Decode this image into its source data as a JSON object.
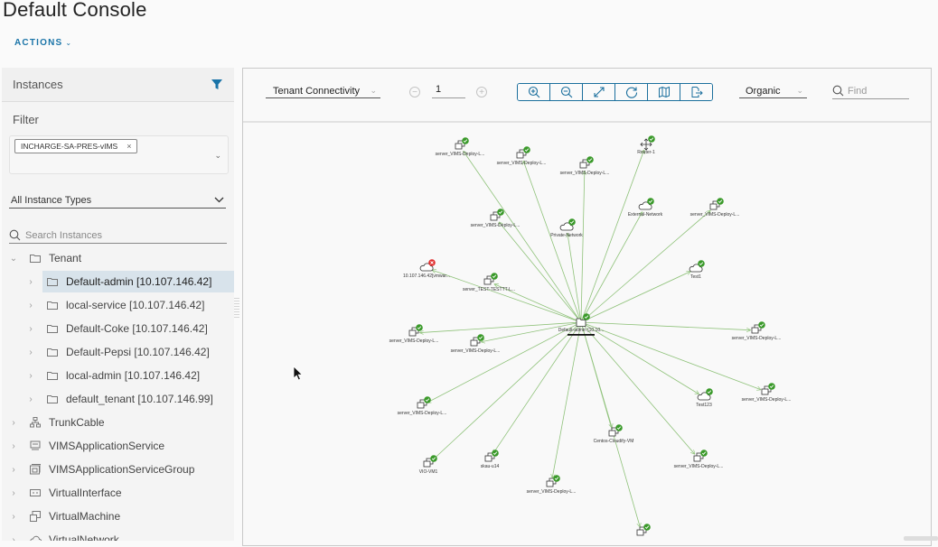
{
  "page": {
    "title": "Default Console",
    "actions_label": "ACTIONS"
  },
  "sidebar": {
    "header": "Instances",
    "filter_label": "Filter",
    "filter_tags": [
      "INCHARGE-SA-PRES-vIMS"
    ],
    "instance_type": "All Instance Types",
    "search_placeholder": "Search Instances",
    "tree": [
      {
        "label": "Tenant",
        "level": 0,
        "expanded": true,
        "icon": "folder-icon"
      },
      {
        "label": "Default-admin [10.107.146.42]",
        "level": 1,
        "selected": true,
        "icon": "folder-icon"
      },
      {
        "label": "local-service [10.107.146.42]",
        "level": 1,
        "icon": "folder-icon"
      },
      {
        "label": "Default-Coke [10.107.146.42]",
        "level": 1,
        "icon": "folder-icon"
      },
      {
        "label": "Default-Pepsi [10.107.146.42]",
        "level": 1,
        "icon": "folder-icon"
      },
      {
        "label": "local-admin [10.107.146.42]",
        "level": 1,
        "icon": "folder-icon"
      },
      {
        "label": "default_tenant [10.107.146.99]",
        "level": 1,
        "icon": "folder-icon"
      },
      {
        "label": "TrunkCable",
        "level": 0,
        "icon": "network-tree-icon"
      },
      {
        "label": "VIMSApplicationService",
        "level": 0,
        "icon": "application-service-icon"
      },
      {
        "label": "VIMSApplicationServiceGroup",
        "level": 0,
        "icon": "service-group-icon"
      },
      {
        "label": "VirtualInterface",
        "level": 0,
        "icon": "interface-icon"
      },
      {
        "label": "VirtualMachine",
        "level": 0,
        "icon": "vm-icon"
      },
      {
        "label": "VirtualNetwork",
        "level": 0,
        "icon": "cloud-icon"
      }
    ]
  },
  "toolbar": {
    "view": "Tenant Connectivity",
    "hop_value": "1",
    "buttons": [
      {
        "name": "zoom-in-button",
        "icon": "zoom-in-icon"
      },
      {
        "name": "zoom-out-button",
        "icon": "zoom-out-icon"
      },
      {
        "name": "fit-to-screen-button",
        "icon": "expand-icon"
      },
      {
        "name": "refresh-button",
        "icon": "refresh-icon"
      },
      {
        "name": "map-button",
        "icon": "map-icon"
      },
      {
        "name": "export-button",
        "icon": "export-icon"
      }
    ],
    "layout": "Organic",
    "find_placeholder": "Find"
  },
  "graph": {
    "center": {
      "label": "Default-admin [10.10...",
      "type": "folder",
      "status": "ok"
    },
    "colors": {
      "edge": "#8fc27a",
      "ok": "#3a9a2a",
      "error": "#e12e2e"
    },
    "nodes": [
      {
        "label": "server_VIMS-Deploy-L...",
        "type": "vm",
        "status": "ok"
      },
      {
        "label": "server_VIMS-Deploy-L...",
        "type": "vm",
        "status": "ok"
      },
      {
        "label": "server_VIMS-Deploy-L...",
        "type": "vm",
        "status": "ok"
      },
      {
        "label": "Router-1",
        "type": "router",
        "status": "ok"
      },
      {
        "label": "server_VIMS-Deploy-L...",
        "type": "vm",
        "status": "ok"
      },
      {
        "label": "Private-Network",
        "type": "cloud",
        "status": "ok"
      },
      {
        "label": "External-Network",
        "type": "cloud",
        "status": "ok"
      },
      {
        "label": "server_VIMS-Deploy-L...",
        "type": "vm",
        "status": "ok"
      },
      {
        "label": "10.107.146.42[vmwar...",
        "type": "cloud",
        "status": "error"
      },
      {
        "label": "server_TEST-TESTTT-L...",
        "type": "vm",
        "status": "ok"
      },
      {
        "label": "Test1",
        "type": "cloud",
        "status": "ok"
      },
      {
        "label": "server_VIMS-Deploy-L...",
        "type": "vm",
        "status": "ok"
      },
      {
        "label": "server_VIMS-Deploy-L...",
        "type": "vm",
        "status": "ok"
      },
      {
        "label": "server_VIMS-Deploy-L...",
        "type": "vm",
        "status": "ok"
      },
      {
        "label": "Test123",
        "type": "cloud",
        "status": "ok"
      },
      {
        "label": "server_VIMS-Deploy-L...",
        "type": "vm",
        "status": "ok"
      },
      {
        "label": "server_VIMS-Deploy-L...",
        "type": "vm",
        "status": "ok"
      },
      {
        "label": "Centos-Cloudify-VM",
        "type": "vm",
        "status": "ok"
      },
      {
        "label": "VIO-VM1",
        "type": "vm",
        "status": "ok"
      },
      {
        "label": "skau-u14",
        "type": "vm",
        "status": "ok"
      },
      {
        "label": "server_VIMS-Deploy-L...",
        "type": "vm",
        "status": "ok"
      },
      {
        "label": "server_VIMS-Deploy-L...",
        "type": "vm",
        "status": "ok"
      },
      {
        "label": "",
        "type": "vm",
        "status": "ok"
      }
    ]
  }
}
